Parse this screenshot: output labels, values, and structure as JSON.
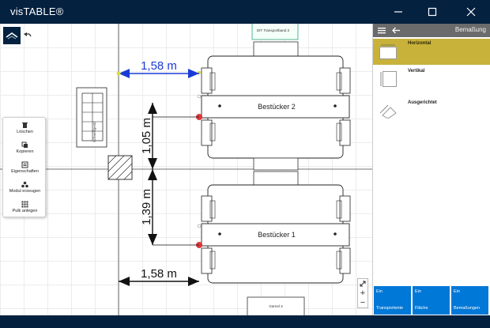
{
  "window": {
    "title": "visTABLE®"
  },
  "toolbar": {
    "logo_icon": "vistable-logo-icon",
    "undo_icon": "undo-icon"
  },
  "plan": {
    "conveyor_top_label": "DIT Transportband 2",
    "station_2_label": "Bestücker 2",
    "station_1_label": "Bestücker 1",
    "bottom_label": "Garnel 3",
    "left_rack_label": "Schweißgerät"
  },
  "dimensions": {
    "top_horizontal": "1,58 m",
    "upper_vertical": "1,05 m",
    "lower_vertical": "1,39 m",
    "bottom_horizontal": "1,58 m",
    "accent_blue": "#1a3bd6"
  },
  "context_menu": {
    "items": [
      {
        "label": "Löschen",
        "icon": "trash-icon"
      },
      {
        "label": "Kopieren",
        "icon": "copy-icon"
      },
      {
        "label": "Eigenschaften",
        "icon": "properties-icon"
      },
      {
        "label": "Modul erzeugen",
        "icon": "module-icon"
      },
      {
        "label": "Pulk anlegen",
        "icon": "grid-icon"
      }
    ]
  },
  "zoom": {
    "expand_icon": "expand-icon",
    "plus": "+",
    "minus": "−"
  },
  "panel": {
    "title": "Bemaßung",
    "options": [
      {
        "label": "Horizontal",
        "selected": true
      },
      {
        "label": "Vertikal",
        "selected": false
      },
      {
        "label": "Ausgerichtet",
        "selected": false
      }
    ],
    "selected_color": "#c8b23a"
  },
  "tiles": [
    {
      "line1": "Ein",
      "line2": "Transportente"
    },
    {
      "line1": "Ein",
      "line2": "Fläche"
    },
    {
      "line1": "Ein",
      "line2": "Bemaßungen"
    }
  ],
  "colors": {
    "titlebar": "#04213f",
    "tile_blue": "#0078d7"
  }
}
